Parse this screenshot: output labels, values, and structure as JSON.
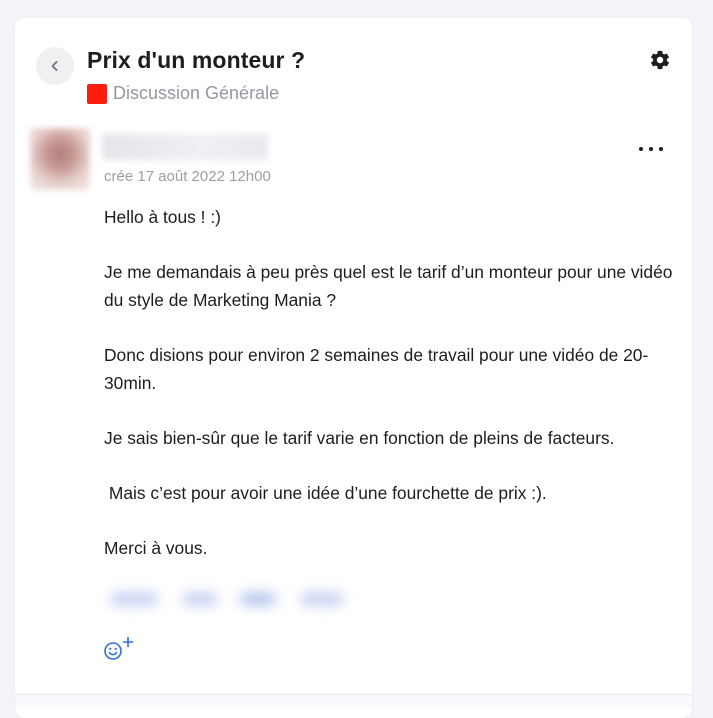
{
  "topic": {
    "title": "Prix d'un monteur ?",
    "category": {
      "label": "Discussion Générale",
      "color": "#ff1d0e"
    }
  },
  "post": {
    "created_label": "crée 17 août 2022 12h00",
    "paragraphs": [
      "Hello à tous ! :)",
      "Je me demandais à peu près quel est le tarif d’un monteur pour une vidéo du style de Marketing Mania ?",
      "Donc disions pour environ 2 semaines de travail pour une vidéo de 20-30min.",
      "Je sais bien-sûr que le tarif varie en fonction de pleins de facteurs.",
      " Mais c’est pour avoir une idée d’une fourchette de prix :).",
      "Merci à vous."
    ]
  },
  "icons": {
    "back": "chevron-left-icon",
    "settings": "gear-icon",
    "more": "more-horizontal-icon",
    "add_reaction": "smiley-plus-icon"
  },
  "colors": {
    "accent": "#2f6fe0",
    "text": "#1b1d21",
    "muted": "#9a9ea6"
  }
}
